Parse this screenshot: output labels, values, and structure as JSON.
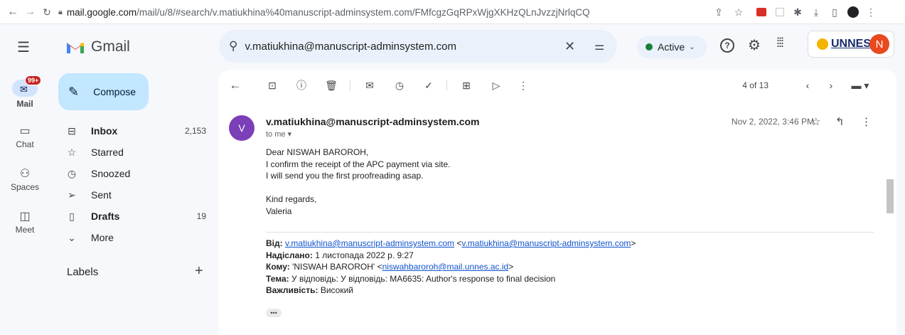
{
  "browser": {
    "url_host": "mail.google.com",
    "url_path": "/mail/u/8/#search/v.matiukhina%40manuscript-adminsystem.com/FMfcgzGqRPxWjgXKHzQLnJvzzjNrlqCQ"
  },
  "header": {
    "app_name": "Gmail",
    "search_value": "v.matiukhina@manuscript-adminsystem.com",
    "status": "Active",
    "org_logo": "UNNES",
    "avatar_letter": "N"
  },
  "rail": [
    {
      "label": "Mail",
      "badge": "99+"
    },
    {
      "label": "Chat"
    },
    {
      "label": "Spaces"
    },
    {
      "label": "Meet"
    }
  ],
  "nav": {
    "compose_label": "Compose",
    "items": [
      {
        "label": "Inbox",
        "count": "2,153"
      },
      {
        "label": "Starred",
        "count": ""
      },
      {
        "label": "Snoozed",
        "count": ""
      },
      {
        "label": "Sent",
        "count": ""
      },
      {
        "label": "Drafts",
        "count": "19"
      },
      {
        "label": "More",
        "count": ""
      }
    ],
    "labels_title": "Labels"
  },
  "toolbar": {
    "pager": "4 of 13"
  },
  "message": {
    "avatar_letter": "V",
    "sender": "v.matiukhina@manuscript-adminsystem.com",
    "to": "to me",
    "date": "Nov 2, 2022, 3:46 PM",
    "body_lines": [
      "Dear NISWAH BAROROH,",
      "I confirm the receipt of the APC payment via site.",
      "I will send you the first proofreading asap.",
      "",
      "Kind regards,",
      "Valeria"
    ],
    "forward": {
      "from_label": "Від:",
      "from_link1": "v.matiukhina@manuscript-adminsystem.com",
      "from_link2": "v.matiukhina@manuscript-adminsystem.com",
      "sent_label": "Надіслано:",
      "sent_value": "1 листопада 2022 р. 9:27",
      "to_label": "Кому:",
      "to_name": "'NISWAH BAROROH'",
      "to_link": "niswahbaroroh@mail.unnes.ac.id",
      "subject_label": "Тема:",
      "subject_value": "У відповідь: У відповідь: MA6635: Author's response to final decision",
      "importance_label": "Важливість:",
      "importance_value": "Високий"
    }
  }
}
